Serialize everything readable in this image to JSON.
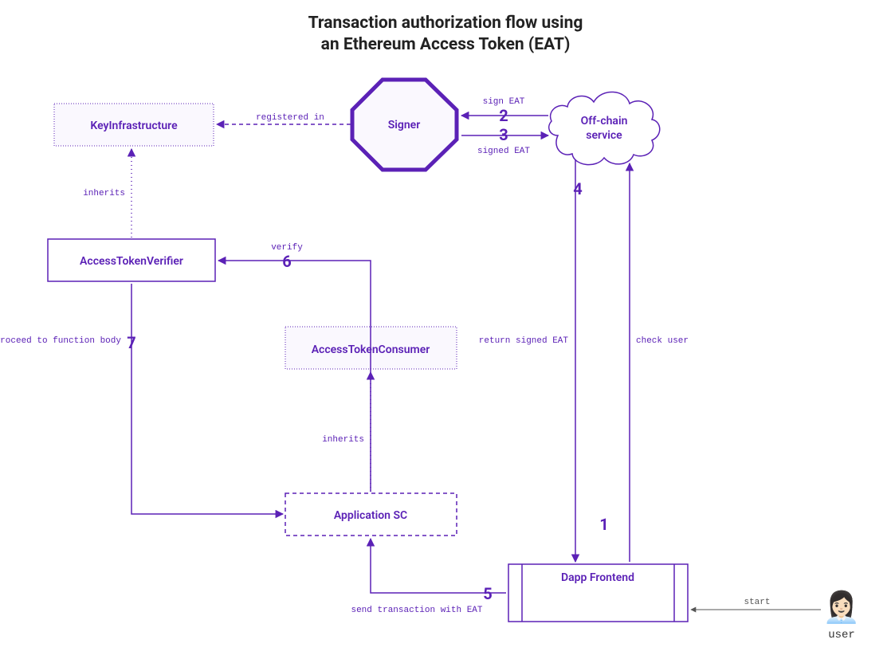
{
  "title_line1": "Transaction authorization flow using",
  "title_line2": "an Ethereum Access Token (EAT)",
  "nodes": {
    "key_infra": "KeyInfrastructure",
    "signer": "Signer",
    "offchain_line1": "Off-chain",
    "offchain_line2": "service",
    "atv": "AccessTokenVerifier",
    "atc": "AccessTokenConsumer",
    "app_sc": "Application SC",
    "dapp": "Dapp Frontend",
    "user": "user"
  },
  "edges": {
    "registered_in": "registered in",
    "sign_eat": "sign EAT",
    "signed_eat": "signed EAT",
    "inherits1": "inherits",
    "inherits2": "inherits",
    "verify": "verify",
    "proceed": "proceed to function body",
    "return_signed": "return signed EAT",
    "check_user": "check user",
    "send_tx": "send transaction with EAT",
    "start": "start"
  },
  "steps": {
    "s1": "1",
    "s2": "2",
    "s3": "3",
    "s4": "4",
    "s5": "5",
    "s6": "6",
    "s7": "7"
  }
}
